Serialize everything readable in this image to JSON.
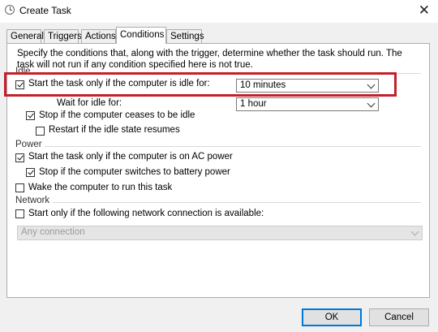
{
  "window": {
    "title": "Create Task",
    "close_glyph": "✕"
  },
  "tabs": [
    {
      "label": "General"
    },
    {
      "label": "Triggers"
    },
    {
      "label": "Actions"
    },
    {
      "label": "Conditions",
      "active": true
    },
    {
      "label": "Settings"
    }
  ],
  "description": "Specify the conditions that, along with the trigger, determine whether the task should run.  The task will not run  if any condition specified here is not true.",
  "idle": {
    "group_label": "Idle",
    "start_if_idle": {
      "label": "Start the task only if the computer is idle for:",
      "checked": true
    },
    "idle_duration": {
      "value": "10 minutes"
    },
    "wait_label": "Wait for idle for:",
    "wait_duration": {
      "value": "1 hour"
    },
    "stop_if_not_idle": {
      "label": "Stop if the computer ceases to be idle",
      "checked": true
    },
    "restart_if_idle": {
      "label": "Restart if the idle state resumes",
      "checked": false
    }
  },
  "power": {
    "group_label": "Power",
    "ac_power": {
      "label": "Start the task only if the computer is on AC power",
      "checked": true
    },
    "battery_stop": {
      "label": "Stop if the computer switches to battery power",
      "checked": true
    },
    "wake": {
      "label": "Wake the computer to run this task",
      "checked": false
    }
  },
  "network": {
    "group_label": "Network",
    "network_start": {
      "label": "Start only if the following network connection is available:",
      "checked": false
    },
    "connection": {
      "value": "Any connection"
    }
  },
  "buttons": {
    "ok": "OK",
    "cancel": "Cancel"
  },
  "colors": {
    "highlight": "#c4202a",
    "default_button_border": "#0078d7"
  }
}
